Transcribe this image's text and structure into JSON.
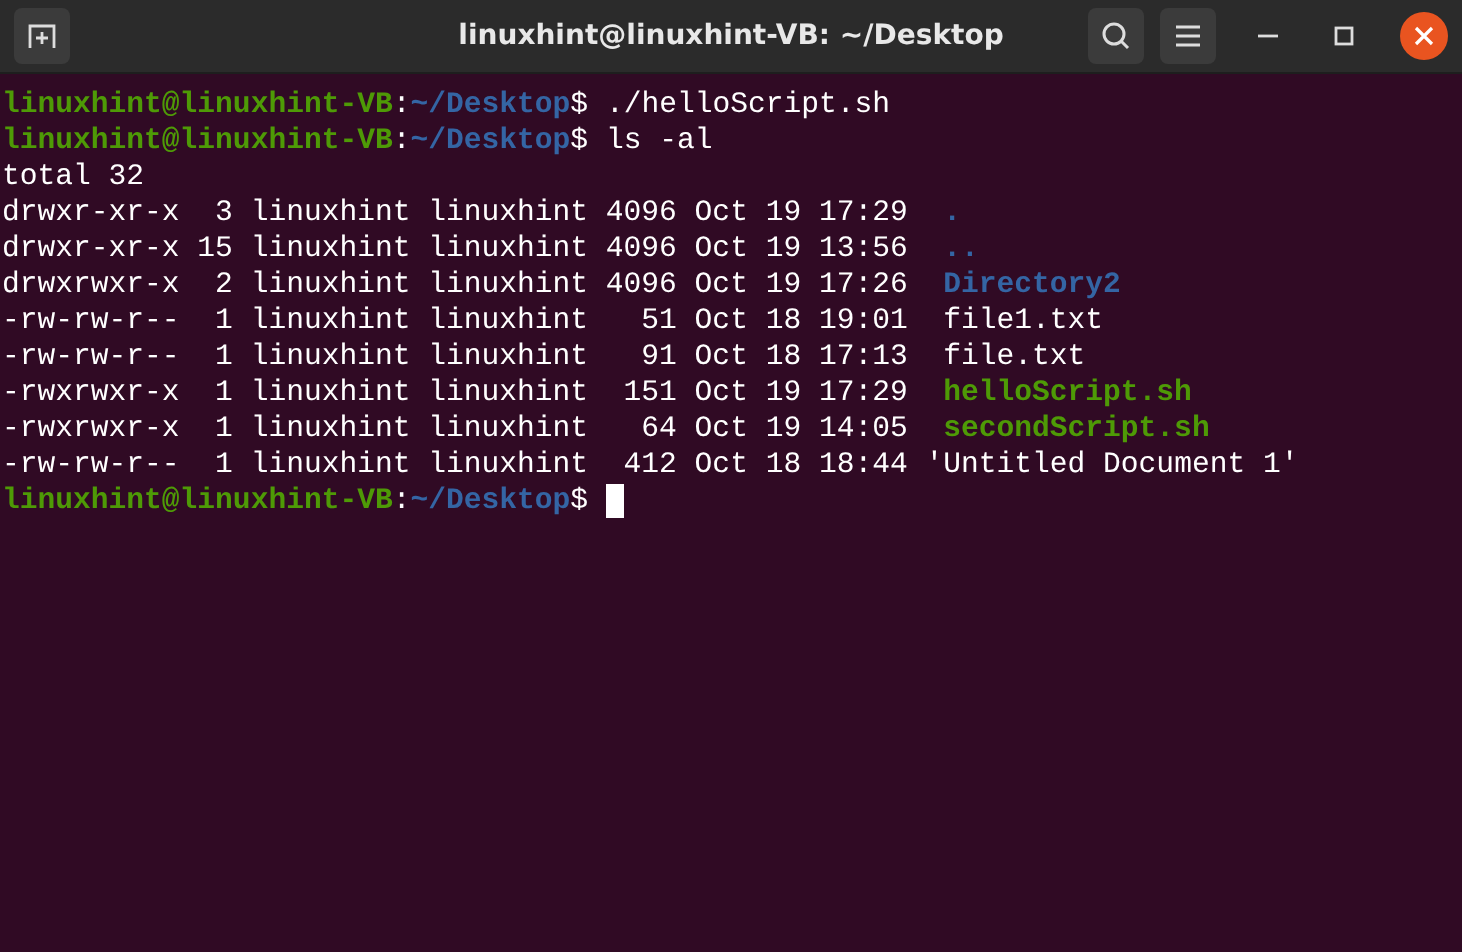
{
  "window": {
    "title": "linuxhint@linuxhint-VB: ~/Desktop"
  },
  "lines": [
    {
      "kind": "prompt",
      "user": "linuxhint@linuxhint-VB",
      "sep": ":",
      "path": "~/Desktop",
      "suffix": "$",
      "command": "./helloScript.sh"
    },
    {
      "kind": "prompt",
      "user": "linuxhint@linuxhint-VB",
      "sep": ":",
      "path": "~/Desktop",
      "suffix": "$",
      "command": "ls -al"
    },
    {
      "kind": "output",
      "text": "total 32"
    },
    {
      "kind": "entry",
      "meta": "drwxr-xr-x  3 linuxhint linuxhint 4096 Oct 19 17:29  ",
      "file": {
        "name": ".",
        "kind": "dir"
      }
    },
    {
      "kind": "entry",
      "meta": "drwxr-xr-x 15 linuxhint linuxhint 4096 Oct 19 13:56  ",
      "file": {
        "name": "..",
        "kind": "dir"
      }
    },
    {
      "kind": "entry",
      "meta": "drwxrwxr-x  2 linuxhint linuxhint 4096 Oct 19 17:26  ",
      "file": {
        "name": "Directory2",
        "kind": "dir"
      }
    },
    {
      "kind": "entry",
      "meta": "-rw-rw-r--  1 linuxhint linuxhint   51 Oct 18 19:01  ",
      "file": {
        "name": "file1.txt",
        "kind": "file"
      }
    },
    {
      "kind": "entry",
      "meta": "-rw-rw-r--  1 linuxhint linuxhint   91 Oct 18 17:13  ",
      "file": {
        "name": "file.txt",
        "kind": "file"
      }
    },
    {
      "kind": "entry",
      "meta": "-rwxrwxr-x  1 linuxhint linuxhint  151 Oct 19 17:29  ",
      "file": {
        "name": "helloScript.sh",
        "kind": "exec"
      }
    },
    {
      "kind": "entry",
      "meta": "-rwxrwxr-x  1 linuxhint linuxhint   64 Oct 19 14:05  ",
      "file": {
        "name": "secondScript.sh",
        "kind": "exec"
      }
    },
    {
      "kind": "entry",
      "meta": "-rw-rw-r--  1 linuxhint linuxhint  412 Oct 18 18:44 ",
      "file": {
        "name": "'Untitled Document 1'",
        "kind": "file"
      }
    },
    {
      "kind": "prompt",
      "user": "linuxhint@linuxhint-VB",
      "sep": ":",
      "path": "~/Desktop",
      "suffix": "$",
      "cursor": true
    }
  ]
}
